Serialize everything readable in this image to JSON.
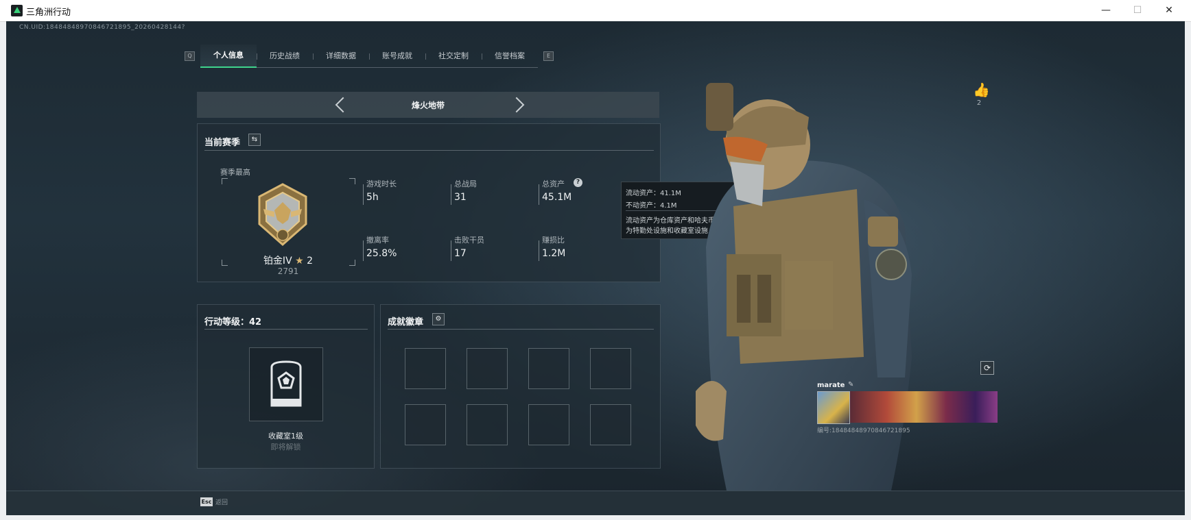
{
  "window": {
    "title": "三角洲行动",
    "minimize": "—",
    "maximize": "☐",
    "close": "✕"
  },
  "uid": "CN.UID:18484848970846721895_20260428144?",
  "tabs": [
    {
      "label": "个人信息",
      "active": true
    },
    {
      "label": "历史战绩"
    },
    {
      "label": "详细数据"
    },
    {
      "label": "账号成就"
    },
    {
      "label": "社交定制"
    },
    {
      "label": "信誉档案"
    }
  ],
  "tab_keys": {
    "left": "Q",
    "right": "E"
  },
  "mode": {
    "label": "烽火地带"
  },
  "season": {
    "title": "当前赛季",
    "best_label": "赛季最高",
    "rank_name": "铂金IV",
    "rank_stars": "2",
    "rank_points": "2791",
    "stats": [
      {
        "label": "游戏时长",
        "value": "5h"
      },
      {
        "label": "总战局",
        "value": "31"
      },
      {
        "label": "总资产",
        "value": "45.1M"
      },
      {
        "label": "撤离率",
        "value": "25.8%"
      },
      {
        "label": "击败干员",
        "value": "17"
      },
      {
        "label": "赚损比",
        "value": "1.2M"
      }
    ]
  },
  "tooltip": {
    "liquid": "流动资产：41.1M",
    "fixed": "不动资产：4.1M",
    "desc_1": "流动资产为仓库资产和哈夫币，不动资产",
    "desc_2": "为特勤处设施和收藏室设施"
  },
  "action_level": {
    "title": "行动等级：42",
    "room_label": "收藏室1级",
    "room_sub": "即将解锁"
  },
  "badges": {
    "title": "成就徽章"
  },
  "like": {
    "count": "2"
  },
  "player": {
    "name": "marate",
    "id_text": "编号:18484848970846721895"
  },
  "footer": {
    "esc_key": "Esc",
    "esc_label": "返回"
  },
  "colors": {
    "accent": "#3fd58d",
    "rank_gold": "#c9a45e",
    "panel_bg": "#202c35"
  },
  "icons": {
    "like": "thumbs-up-icon",
    "refresh": "refresh-icon",
    "edit": "pencil-icon",
    "settings": "gear-icon",
    "swap": "swap-icon",
    "help": "question-icon"
  }
}
